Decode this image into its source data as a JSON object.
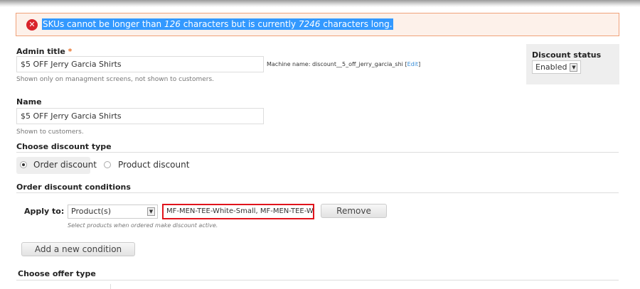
{
  "error": {
    "part1": "SKUs cannot be longer than ",
    "max": "126",
    "part2": " characters but is currently ",
    "current": "7246",
    "part3": " characters long."
  },
  "admin_title": {
    "label": "Admin title",
    "required": "*",
    "value": "$5 OFF Jerry Garcia Shirts",
    "machine_label": "Machine name: discount__5_off_jerry_garcia_shi",
    "edit_open": "[",
    "edit": "Edit",
    "edit_close": "]",
    "help": "Shown only on managment screens, not shown to customers."
  },
  "status": {
    "label": "Discount status",
    "value": "Enabled"
  },
  "name": {
    "label": "Name",
    "value": "$5 OFF Jerry Garcia Shirts",
    "help": "Shown to customers."
  },
  "discount_type": {
    "label": "Choose discount type",
    "options": [
      "Order discount",
      "Product discount"
    ],
    "selected": "Order discount"
  },
  "conditions": {
    "label": "Order discount conditions",
    "apply_label": "Apply to:",
    "apply_value": "Product(s)",
    "skus": "MF-MEN-TEE-White-Small, MF-MEN-TEE-White",
    "help": "Select products when ordered make discount active.",
    "remove": "Remove",
    "add": "Add a new condition"
  },
  "offer": {
    "label": "Choose offer type"
  }
}
